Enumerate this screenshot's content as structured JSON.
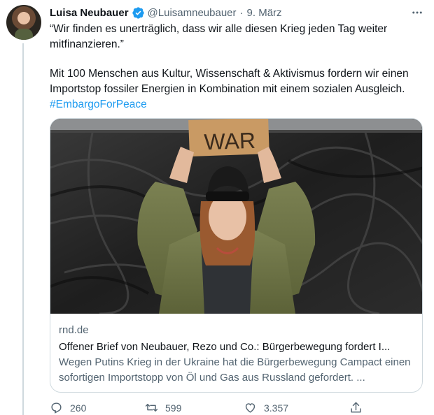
{
  "tweet": {
    "author_name": "Luisa Neubauer",
    "handle": "@Luisamneubauer",
    "separator": "·",
    "date": "9. März",
    "text_line1": "“Wir finden es unerträglich, dass wir alle diesen Krieg jeden Tag weiter mitfinanzieren.”",
    "text_line2": "Mit 100 Menschen aus Kultur, Wissenschaft & Aktivismus fordern wir einen Importstop fossiler Energien in Kombination mit einem sozialen Ausgleich.",
    "hashtag": "#EmbargoForPeace"
  },
  "card": {
    "image_sign_text": "WAR",
    "domain": "rnd.de",
    "title": "Offener Brief von Neubauer, Rezo und Co.: Bürgerbewegung fordert I...",
    "description": "Wegen Putins Krieg in der Ukraine hat die Bürgerbewegung Campact einen sofortigen Importstopp von Öl und Gas aus Russland gefordert. ..."
  },
  "actions": {
    "replies": "260",
    "retweets": "599",
    "likes": "3.357"
  },
  "icons": {
    "verified": "verified-badge-icon",
    "more": "more-options-icon",
    "reply": "reply-icon",
    "retweet": "retweet-icon",
    "like": "heart-icon",
    "share": "share-icon"
  },
  "colors": {
    "accent": "#1d9bf0",
    "secondary_text": "#536471",
    "border": "#cfd9de"
  }
}
